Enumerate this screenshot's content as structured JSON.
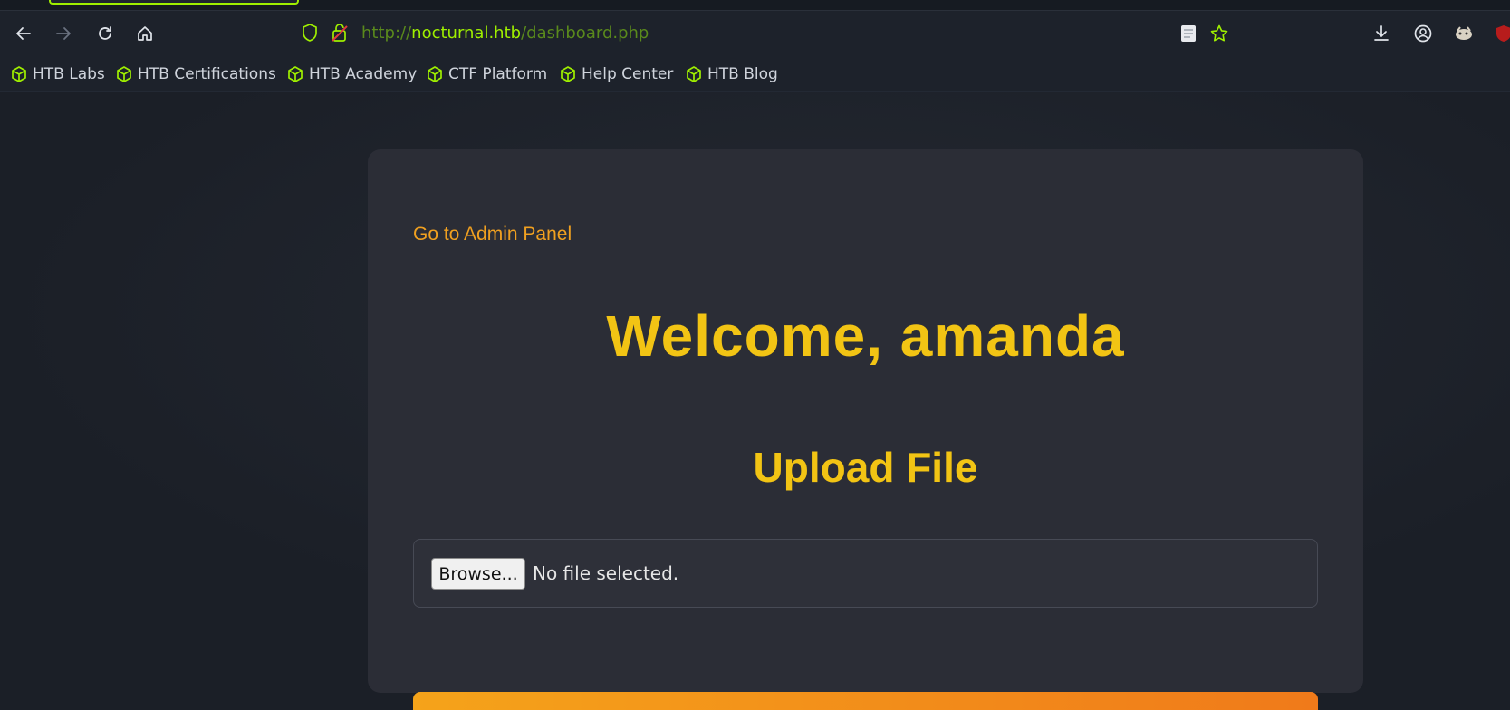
{
  "browser": {
    "url_protocol": "http://",
    "url_host": "nocturnal.htb",
    "url_path": "/dashboard.php",
    "bookmarks": [
      {
        "label": "HTB Labs"
      },
      {
        "label": "HTB Certifications"
      },
      {
        "label": "HTB Academy"
      },
      {
        "label": "CTF Platform"
      },
      {
        "label": "Help Center"
      },
      {
        "label": "HTB Blog"
      }
    ],
    "accent_color": "#9fef00"
  },
  "dashboard": {
    "admin_link": "Go to Admin Panel",
    "welcome": "Welcome, amanda",
    "upload_title": "Upload File",
    "browse_button": "Browse...",
    "file_status": "No file selected.",
    "title_color": "#f2c414",
    "link_color": "#f0a020"
  }
}
